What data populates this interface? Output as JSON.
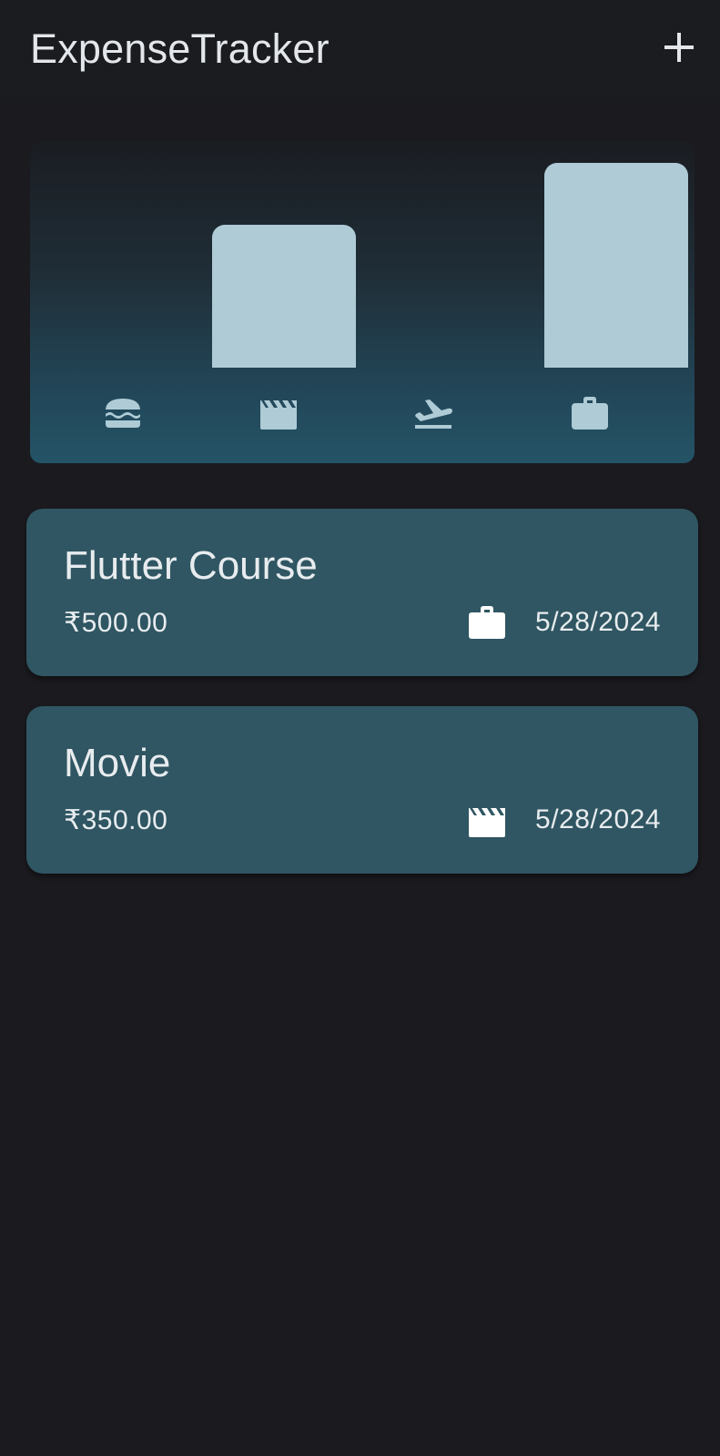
{
  "app": {
    "title": "ExpenseTracker",
    "add_icon": "plus-icon"
  },
  "chart_data": {
    "type": "bar",
    "categories": [
      "food",
      "leisure",
      "travel",
      "work"
    ],
    "category_icons": [
      "burger-icon",
      "movie-clapper-icon",
      "flight-takeoff-icon",
      "briefcase-icon"
    ],
    "values": [
      0,
      350,
      0,
      500
    ],
    "ylim": [
      0,
      500
    ],
    "bar_color": "#aecbd6",
    "grid": false
  },
  "expenses": [
    {
      "title": "Flutter Course",
      "amount": "₹500.00",
      "category_icon": "briefcase-icon",
      "date": "5/28/2024"
    },
    {
      "title": "Movie",
      "amount": "₹350.00",
      "category_icon": "movie-clapper-icon",
      "date": "5/28/2024"
    }
  ],
  "colors": {
    "background": "#1b1a1f",
    "card": "#2f5662",
    "text": "#e8ecef",
    "chart_gradient_bottom": "#245466"
  }
}
